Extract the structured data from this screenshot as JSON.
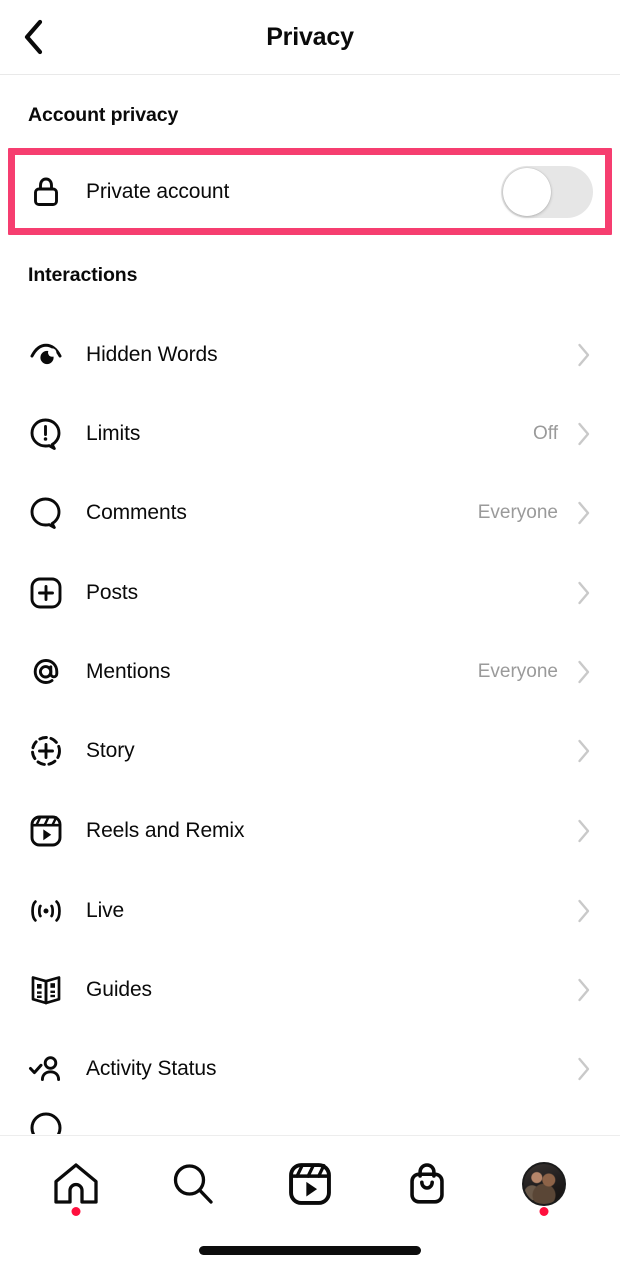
{
  "header": {
    "title": "Privacy",
    "back_icon": "chevron-left-icon"
  },
  "sections": [
    {
      "id": "account-privacy",
      "heading": "Account privacy",
      "highlighted": true,
      "highlight_color": "#F63E70",
      "rows": [
        {
          "label": "Private account",
          "icon": "lock-icon",
          "control": "toggle",
          "toggle_on": false,
          "value": ""
        }
      ]
    },
    {
      "id": "interactions",
      "heading": "Interactions",
      "highlighted": false,
      "rows": [
        {
          "label": "Hidden Words",
          "icon": "eye-hidden-icon",
          "value": "",
          "control": "chevron"
        },
        {
          "label": "Limits",
          "icon": "limits-bubble-icon",
          "value": "Off",
          "control": "chevron"
        },
        {
          "label": "Comments",
          "icon": "comment-bubble-icon",
          "value": "Everyone",
          "control": "chevron"
        },
        {
          "label": "Posts",
          "icon": "post-plus-icon",
          "value": "",
          "control": "chevron"
        },
        {
          "label": "Mentions",
          "icon": "at-mention-icon",
          "value": "Everyone",
          "control": "chevron"
        },
        {
          "label": "Story",
          "icon": "story-plus-icon",
          "value": "",
          "control": "chevron"
        },
        {
          "label": "Reels and Remix",
          "icon": "reels-icon",
          "value": "",
          "control": "chevron"
        },
        {
          "label": "Live",
          "icon": "live-broadcast-icon",
          "value": "",
          "control": "chevron"
        },
        {
          "label": "Guides",
          "icon": "guides-book-icon",
          "value": "",
          "control": "chevron"
        },
        {
          "label": "Activity Status",
          "icon": "activity-status-icon",
          "value": "",
          "control": "chevron"
        }
      ]
    }
  ],
  "bottom_nav": {
    "items": [
      {
        "icon": "home-icon",
        "name": "home",
        "badge": true
      },
      {
        "icon": "search-icon",
        "name": "search",
        "badge": false
      },
      {
        "icon": "reels-icon",
        "name": "reels",
        "badge": false
      },
      {
        "icon": "shop-bag-icon",
        "name": "shop",
        "badge": false
      },
      {
        "icon": "avatar-icon",
        "name": "profile",
        "badge": true
      }
    ],
    "badge_color": "#FF0F3D"
  },
  "colors": {
    "text_primary": "#0a0a0a",
    "text_secondary": "#9a9a9a",
    "chevron": "#c9c9c9",
    "highlight": "#F63E70",
    "toggle_track_off": "#e6e6e6",
    "divider": "#e9e9e9"
  }
}
